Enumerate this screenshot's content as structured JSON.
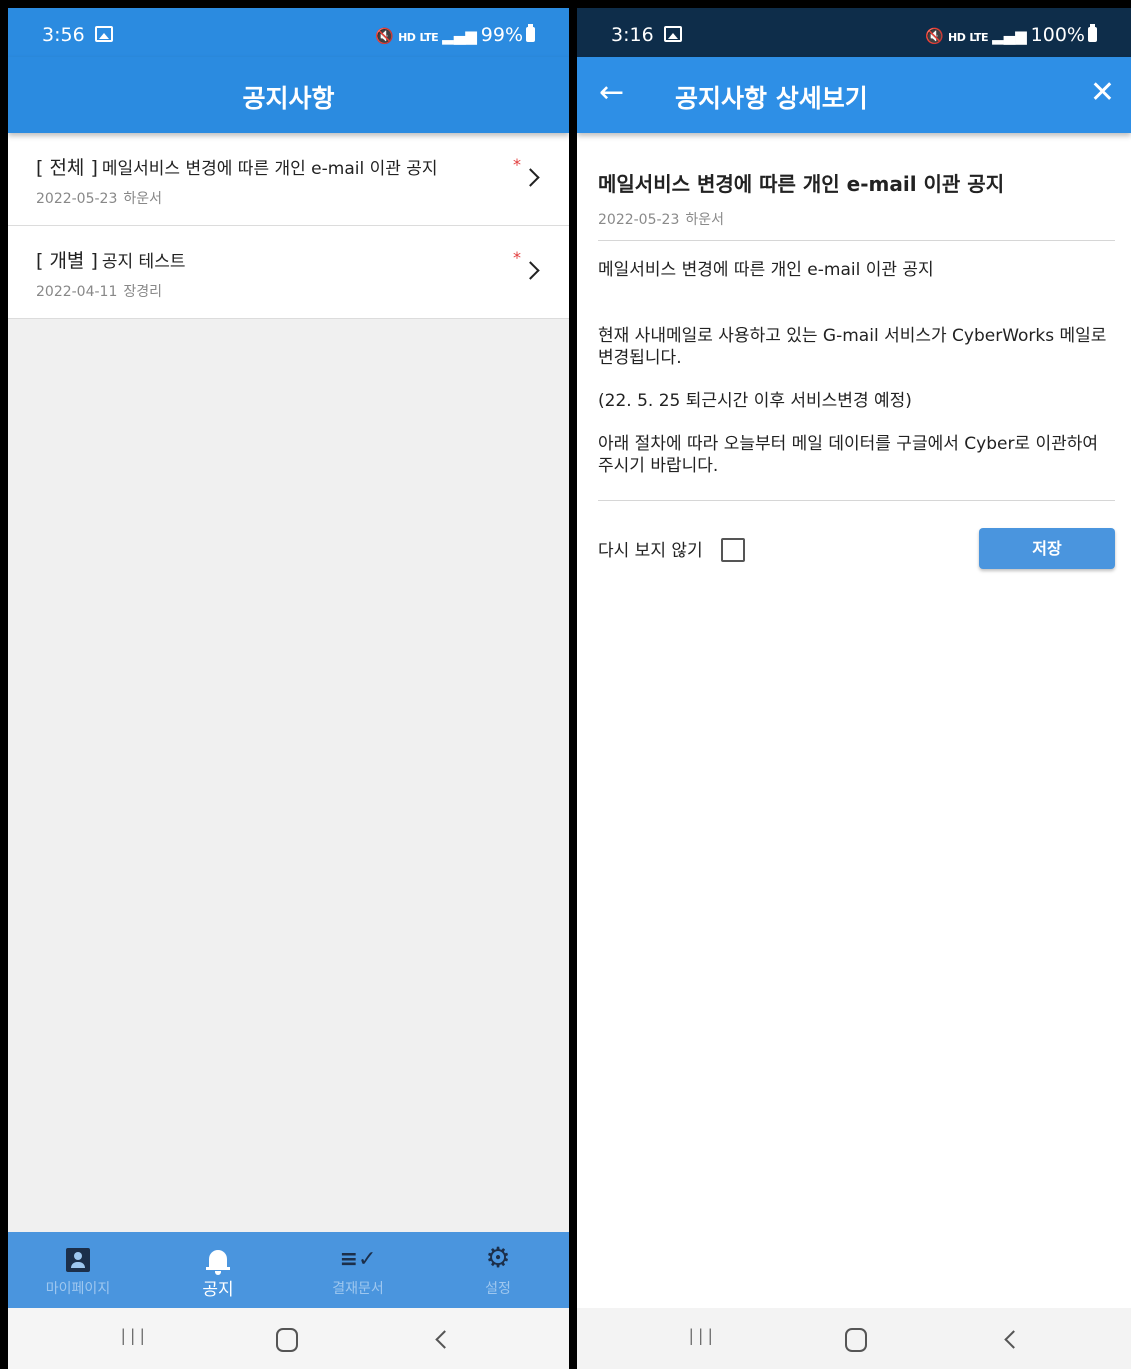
{
  "left": {
    "status": {
      "time": "3:56",
      "hd": "HD",
      "lte": "LTE",
      "battery": "99%"
    },
    "appbar": {
      "title": "공지사항"
    },
    "notices": [
      {
        "category": "[ 전체 ]",
        "title": "메일서비스 변경에 따른 개인 e-mail 이관 공지",
        "date": "2022-05-23",
        "author": "하운서",
        "new_mark": "*"
      },
      {
        "category": "[ 개별 ]",
        "title": "공지 테스트",
        "date": "2022-04-11",
        "author": "장경리",
        "new_mark": "*"
      }
    ],
    "bottom_nav": [
      {
        "label": "마이페이지",
        "icon": "person-icon"
      },
      {
        "label": "공지",
        "icon": "bell-icon",
        "active": true
      },
      {
        "label": "결재문서",
        "icon": "document-check-icon"
      },
      {
        "label": "설정",
        "icon": "gear-icon"
      }
    ]
  },
  "right": {
    "status": {
      "time": "3:16",
      "hd": "HD",
      "lte": "LTE",
      "battery": "100%"
    },
    "appbar": {
      "title": "공지사항 상세보기",
      "back_glyph": "←",
      "close_glyph": "✕"
    },
    "detail": {
      "title": "메일서비스 변경에 따른 개인 e-mail 이관 공지",
      "date": "2022-05-23",
      "author": "하운서",
      "body": [
        "메일서비스 변경에 따른 개인 e-mail 이관 공지",
        "현재 사내메일로 사용하고 있는 G-mail 서비스가 CyberWorks 메일로 변경됩니다.",
        "(22. 5. 25 퇴근시간 이후 서비스변경 예정)",
        "아래 절차에 따라 오늘부터 메일 데이터를 구글에서 Cyber로 이관하여 주시기 바랍니다."
      ],
      "dont_show_label": "다시 보지 않기",
      "dont_show_checked": false,
      "save_label": "저장"
    }
  },
  "system_nav": {
    "recent_glyph": "III"
  },
  "colors": {
    "primary": "#2b8be0",
    "bottom_nav": "#4a95de",
    "status_dark": "#0e2d4a",
    "new_mark": "#e23c3c"
  }
}
